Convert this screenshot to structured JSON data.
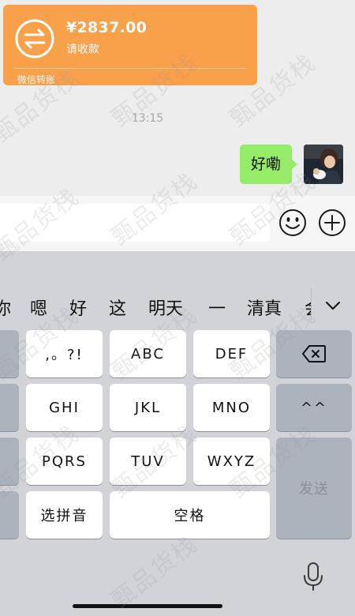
{
  "transfer": {
    "amount": "¥2837.00",
    "status": "请收款",
    "footer": "微信转账",
    "icon": "transfer-arrows-icon",
    "color": "#f9a04b"
  },
  "timestamp": "13:15",
  "message": {
    "text": "好嘞",
    "bubble_color": "#95ec69"
  },
  "avatar": {
    "description": "user-avatar"
  },
  "input": {
    "value": "",
    "placeholder": ""
  },
  "input_buttons": {
    "emoji_icon": "smiley-icon",
    "plus_icon": "plus-icon"
  },
  "candidates": [
    "你",
    "嗯",
    "好",
    "这",
    "明天",
    "一",
    "清真",
    "会"
  ],
  "keys": {
    "punct": ",。?!",
    "abc": "ABC",
    "def": "DEF",
    "ghi": "GHI",
    "jkl": "JKL",
    "mno": "MNO",
    "pqrs": "PQRS",
    "tuv": "TUV",
    "wxyz": "WXYZ",
    "pinyin": "选拼音",
    "space": "空格",
    "face": "^^",
    "send": "发送"
  },
  "watermark": "甄品货栈"
}
